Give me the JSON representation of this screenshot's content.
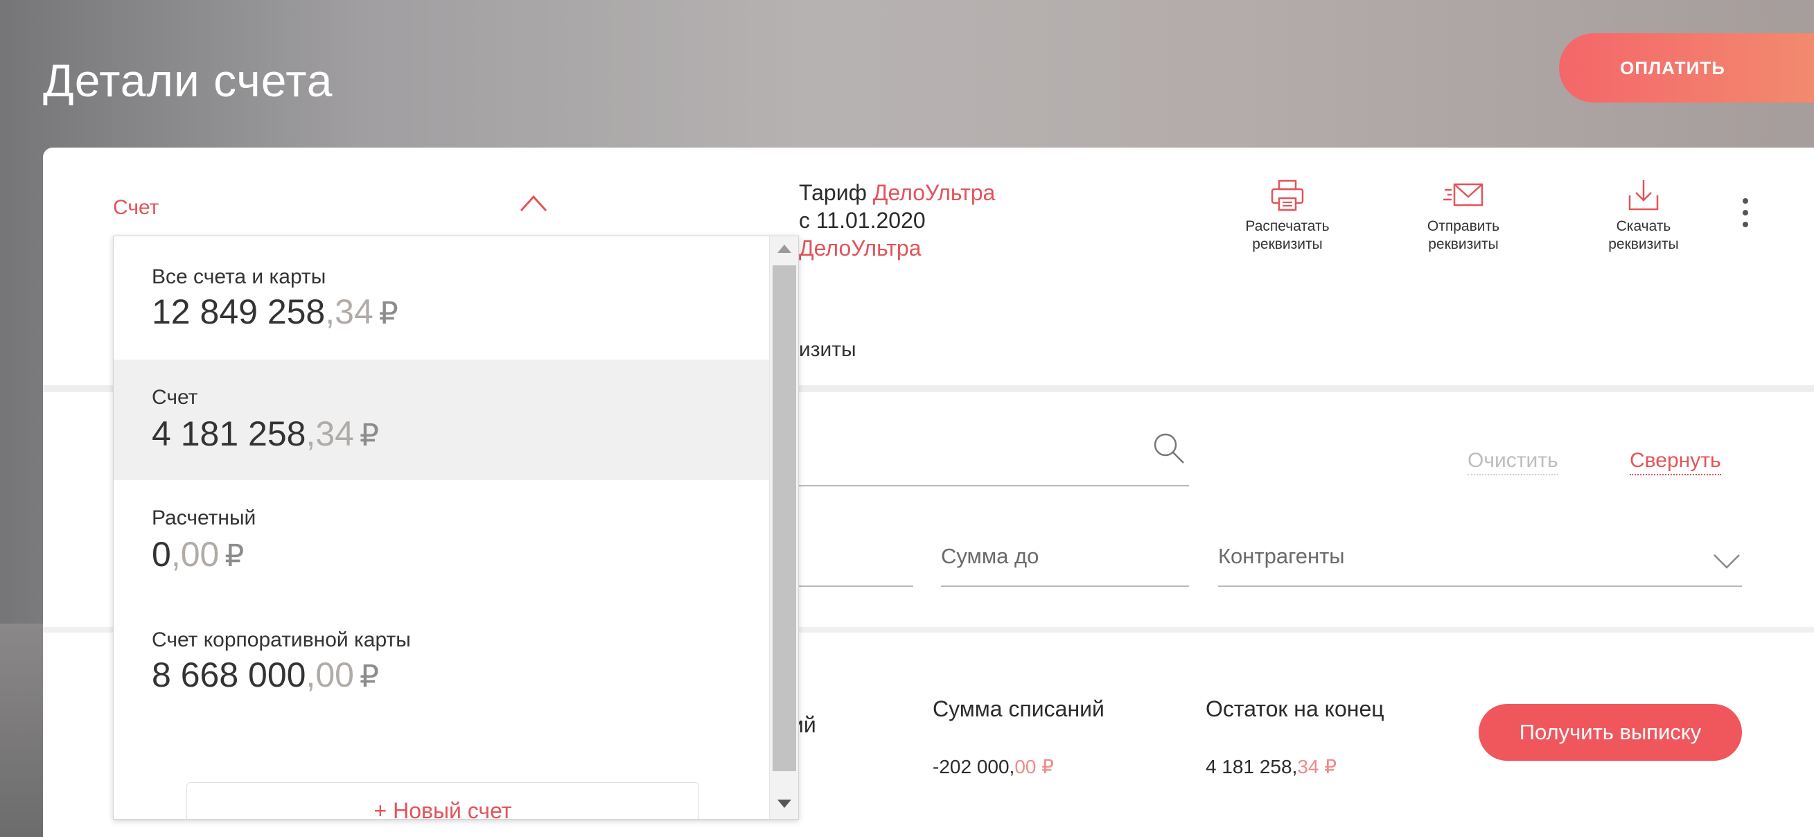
{
  "header": {
    "title": "Детали счета",
    "pay_label": "ОПЛАТИТЬ"
  },
  "account_select": {
    "label": "Счет"
  },
  "tariff": {
    "prefix": "Тариф",
    "name": "ДелоУльтра",
    "since": "с 11.01.2020",
    "second_name": "ДелоУльтра"
  },
  "actions": [
    {
      "icon": "printer-icon",
      "line1": "Распечатать",
      "line2": "реквизиты"
    },
    {
      "icon": "envelope-icon",
      "line1": "Отправить",
      "line2": "реквизиты"
    },
    {
      "icon": "download-icon",
      "line1": "Скачать",
      "line2": "реквизиты"
    }
  ],
  "tab_partial": "изиты",
  "filters": {
    "clear_label": "Очистить",
    "collapse_label": "Свернуть",
    "sum_to_placeholder": "Сумма до",
    "counterparties_placeholder": "Контрагенты"
  },
  "stats": {
    "partial_label": "ий",
    "debits_label": "Сумма списаний",
    "debits_main": "-202 000,",
    "debits_cents": "00 ₽",
    "end_balance_label": "Остаток на конец",
    "end_balance_main": "4 181 258,",
    "end_balance_cents": "34 ₽",
    "get_statement_label": "Получить выписку"
  },
  "dropdown": {
    "items": [
      {
        "name": "Все счета и карты",
        "main": "12 849 258",
        "cents": ",34",
        "currency": "₽",
        "selected": false
      },
      {
        "name": "Счет",
        "main": "4 181 258",
        "cents": ",34",
        "currency": "₽",
        "selected": true
      },
      {
        "name": "Расчетный",
        "main": "0",
        "cents": ",00",
        "currency": "₽",
        "selected": false
      },
      {
        "name": "Счет корпоративной карты",
        "main": "8 668 000",
        "cents": ",00",
        "currency": "₽",
        "selected": false
      }
    ],
    "new_account_label": "+ Новый счет"
  },
  "colors": {
    "accent": "#e2545a",
    "button_gradient_start": "#f4666a",
    "button_gradient_end": "#f28a6e"
  }
}
